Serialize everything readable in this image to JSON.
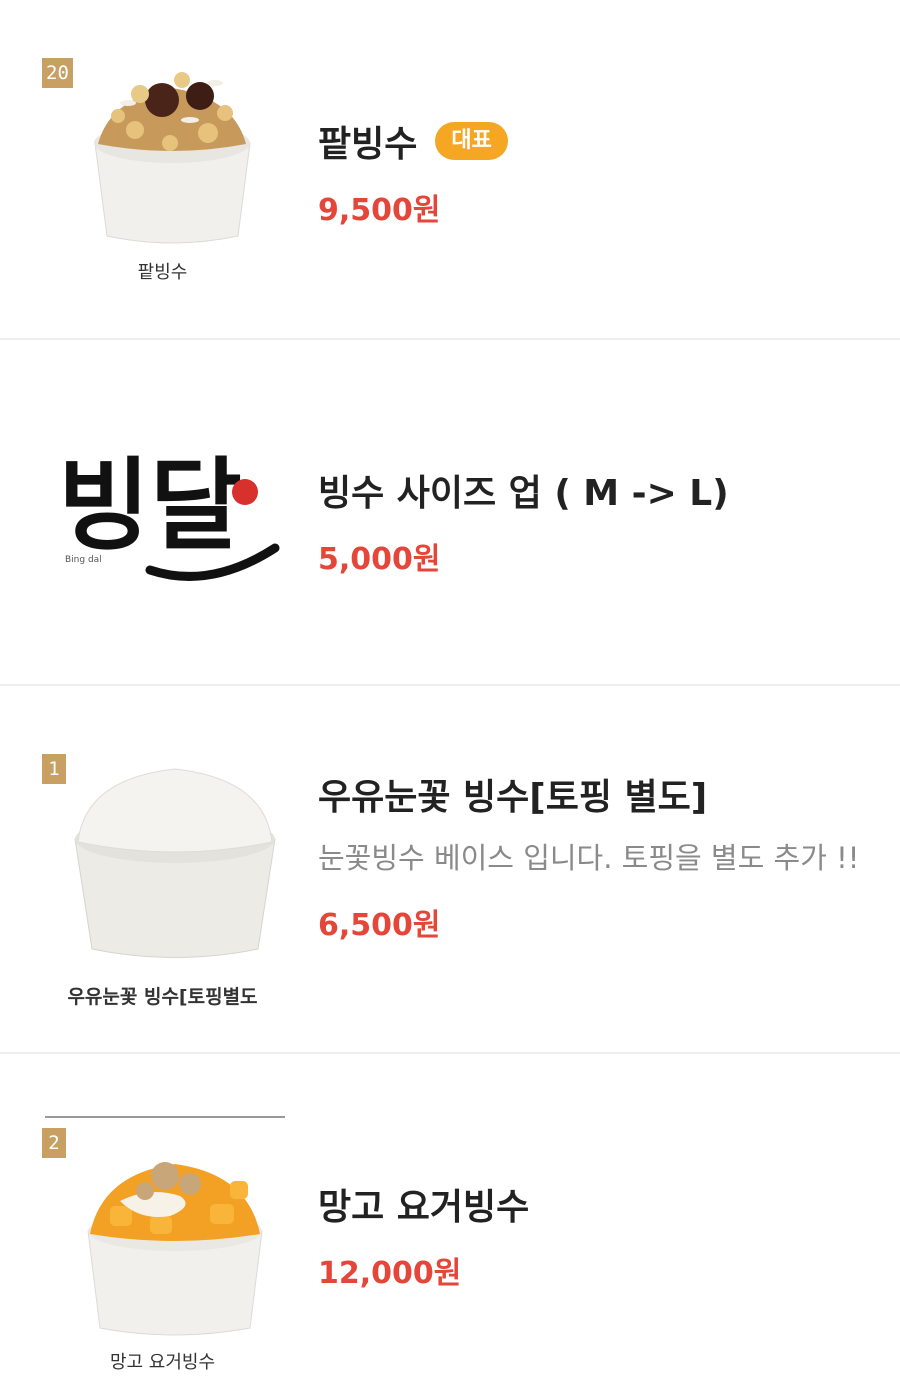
{
  "items": [
    {
      "rank": "20",
      "name": "팥빙수",
      "badge": "대표",
      "price": "9,500원",
      "image_caption": "팥빙수"
    },
    {
      "name": "빙수 사이즈 업 ( M -> L)",
      "price": "5,000원",
      "logo_text": "빙달",
      "logo_small": "Bing dal"
    },
    {
      "rank": "1",
      "name": "우유눈꽃 빙수[토핑 별도]",
      "description": "눈꽃빙수 베이스 입니다. 토핑을 별도 추가 !!",
      "price": "6,500원",
      "image_caption": "우유눈꽃 빙수[토핑별도"
    },
    {
      "rank": "2",
      "name": "망고 요거빙수",
      "price": "12,000원",
      "image_caption": "망고 요거빙수"
    }
  ],
  "colors": {
    "price": "#e5463a",
    "badge": "#f5a623",
    "rank_tag": "#c9a063"
  }
}
